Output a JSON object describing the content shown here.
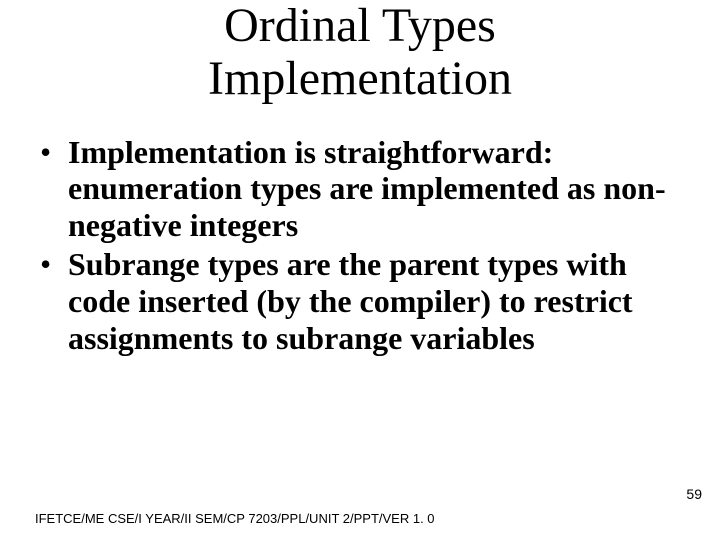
{
  "title": {
    "line1": "Ordinal Types",
    "line2": "Implementation"
  },
  "bullets": [
    "Implementation is straightforward: enumeration types are implemented as non-negative integers",
    "Subrange types are the parent types with code inserted (by the compiler) to restrict assignments to subrange variables"
  ],
  "pageNumber": "59",
  "footer": "IFETCE/ME CSE/I YEAR/II SEM/CP 7203/PPL/UNIT 2/PPT/VER 1. 0"
}
